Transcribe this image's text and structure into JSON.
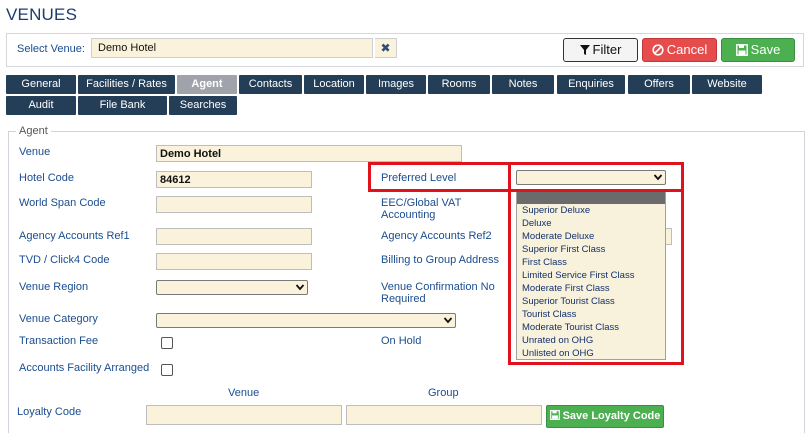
{
  "page": {
    "title": "VENUES"
  },
  "venue_bar": {
    "label": "Select Venue:",
    "value": "Demo Hotel",
    "filter_label": "Filter",
    "cancel_label": "Cancel",
    "save_label": "Save"
  },
  "tabs": [
    {
      "label": "General",
      "active": false
    },
    {
      "label": "Facilities / Rates",
      "active": false
    },
    {
      "label": "Agent",
      "active": true
    },
    {
      "label": "Contacts",
      "active": false
    },
    {
      "label": "Location",
      "active": false
    },
    {
      "label": "Images",
      "active": false
    },
    {
      "label": "Rooms",
      "active": false
    },
    {
      "label": "Notes",
      "active": false
    },
    {
      "label": "Enquiries",
      "active": false
    },
    {
      "label": "Offers",
      "active": false
    },
    {
      "label": "Website",
      "active": false
    },
    {
      "label": "Audit",
      "active": false
    },
    {
      "label": "File Bank",
      "active": false
    },
    {
      "label": "Searches",
      "active": false
    }
  ],
  "agent": {
    "legend": "Agent",
    "venue_label": "Venue",
    "venue_value": "Demo Hotel",
    "hotel_code_label": "Hotel Code",
    "hotel_code_value": "84612",
    "world_span_label": "World Span Code",
    "agency_ref1_label": "Agency Accounts Ref1",
    "tvd_label": "TVD / Click4 Code",
    "region_label": "Venue Region",
    "category_label": "Venue Category",
    "transaction_fee_label": "Transaction Fee",
    "accounts_facility_label": "Accounts Facility Arranged",
    "preferred_level_label": "Preferred Level",
    "eec_vat_label_line1": "EEC/Global VAT",
    "eec_vat_label_line2": "Accounting",
    "agency_ref2_label": "Agency Accounts Ref2",
    "billing_label": "Billing to Group Address",
    "confirmation_label_line1": "Venue Confirmation No",
    "confirmation_label_line2": "Required",
    "on_hold_label": "On Hold",
    "loyalty_code_label": "Loyalty Code",
    "loyalty_venue_header": "Venue",
    "loyalty_group_header": "Group",
    "save_loyalty_label": "Save Loyalty Code"
  },
  "preferred_level_options": [
    "",
    "Superior Deluxe",
    "Deluxe",
    "Moderate Deluxe",
    "Superior First Class",
    "First Class",
    "Limited Service First Class",
    "Moderate First Class",
    "Superior Tourist Class",
    "Tourist Class",
    "Moderate Tourist Class",
    "Unrated on OHG",
    "Unlisted on OHG"
  ],
  "icons": {
    "filter": "funnel-icon",
    "cancel": "ban-icon",
    "save": "floppy-disk-icon",
    "clear": "close-icon",
    "dropdown": "chevron-down-icon"
  },
  "colors": {
    "tab_bg": "#243e58",
    "tab_active_bg": "#a0a4aa",
    "cancel": "#e74c4c",
    "save": "#4caf50",
    "input_bg": "#fbf2dc",
    "highlight_frame": "#e0131d",
    "label_text": "#1a4d8f"
  }
}
